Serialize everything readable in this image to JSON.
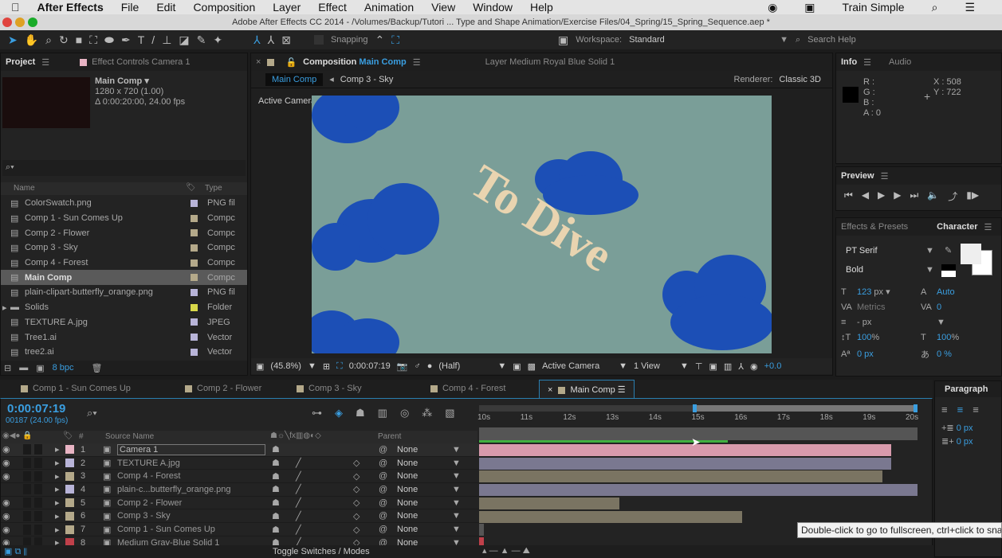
{
  "menubar": {
    "app": "After Effects",
    "items": [
      "File",
      "Edit",
      "Composition",
      "Layer",
      "Effect",
      "Animation",
      "View",
      "Window",
      "Help"
    ],
    "user": "Train Simple"
  },
  "titlebar": {
    "title": "Adobe After Effects CC 2014 - /Volumes/Backup/Tutori ... Type and Shape Animation/Exercise Files/04_Spring/15_Spring_Sequence.aep *"
  },
  "toolbar": {
    "snapping": "Snapping",
    "workspace_label": "Workspace:",
    "workspace": "Standard",
    "search_placeholder": "Search Help"
  },
  "project": {
    "tab": "Project",
    "effect_tab": "Effect Controls Camera 1",
    "comp_name": "Main Comp ▾",
    "comp_size": "1280 x 720 (1.00)",
    "comp_duration": "Δ 0:00:20:00, 24.00 fps",
    "col_name": "Name",
    "col_type": "Type",
    "bpc": "8 bpc",
    "items": [
      {
        "name": "ColorSwatch.png",
        "type": "PNG fil",
        "color": "#b8b4d8"
      },
      {
        "name": "Comp 1 - Sun Comes Up",
        "type": "Compc",
        "color": "#b4a98a"
      },
      {
        "name": "Comp 2 - Flower",
        "type": "Compc",
        "color": "#b4a98a"
      },
      {
        "name": "Comp 3 - Sky",
        "type": "Compc",
        "color": "#b4a98a"
      },
      {
        "name": "Comp 4 - Forest",
        "type": "Compc",
        "color": "#b4a98a"
      },
      {
        "name": "Main Comp",
        "type": "Compc",
        "color": "#b4a98a",
        "selected": true
      },
      {
        "name": "plain-clipart-butterfly_orange.png",
        "type": "PNG fil",
        "color": "#b8b4d8"
      },
      {
        "name": "Solids",
        "type": "Folder",
        "color": "#d8d84a"
      },
      {
        "name": "TEXTURE A.jpg",
        "type": "JPEG",
        "color": "#b8b4d8"
      },
      {
        "name": "Tree1.ai",
        "type": "Vector",
        "color": "#b8b4d8"
      },
      {
        "name": "tree2.ai",
        "type": "Vector",
        "color": "#b8b4d8"
      }
    ]
  },
  "comp": {
    "tab_prefix": "Composition",
    "tab_name": "Main Comp",
    "layer_tab": "Layer Medium Royal Blue Solid 1",
    "crumb1": "Main Comp",
    "crumb2": "Comp 3 - Sky",
    "renderer_label": "Renderer:",
    "renderer": "Classic 3D",
    "view_label": "Active Camera",
    "viewer_text": "To Dive",
    "footer": {
      "zoom": "(45.8%)",
      "time": "0:00:07:19",
      "resolution": "(Half)",
      "camera": "Active Camera",
      "views": "1 View",
      "exposure": "+0.0"
    }
  },
  "info": {
    "tab": "Info",
    "audio_tab": "Audio",
    "r": "R :",
    "g": "G :",
    "b": "B :",
    "a": "A : 0",
    "x": "X : 508",
    "y": "Y : 722"
  },
  "preview": {
    "tab": "Preview"
  },
  "character": {
    "effects_tab": "Effects & Presets",
    "tab": "Character",
    "font": "PT Serif",
    "style": "Bold",
    "size": "123",
    "size_unit": "px",
    "leading": "Auto",
    "kerning": "Metrics",
    "tracking": "0",
    "stroke": "- px",
    "vscale": "100",
    "hscale": "100",
    "pct": "%",
    "baseline": "0 px",
    "tsume": "0 %"
  },
  "paragraph": {
    "tab": "Paragraph",
    "indent1": "0 px",
    "indent2": "0 px"
  },
  "timeline": {
    "tabs": [
      "Comp 1 - Sun Comes Up",
      "Comp 2 - Flower",
      "Comp 3 - Sky",
      "Comp 4 - Forest",
      "Main Comp"
    ],
    "timecode": "0:00:07:19",
    "frames": "00187 (24.00 fps)",
    "col_source": "Source Name",
    "col_parent": "Parent",
    "col_num": "#",
    "toggle": "Toggle Switches / Modes",
    "ruler": [
      "10s",
      "11s",
      "12s",
      "13s",
      "14s",
      "15s",
      "16s",
      "17s",
      "18s",
      "19s",
      "20s"
    ],
    "layers": [
      {
        "num": "1",
        "name": "Camera 1",
        "color": "#e8b4c4",
        "parent": "None",
        "bar_end": 0.94,
        "bar_color": "#d89aac"
      },
      {
        "num": "2",
        "name": "TEXTURE A.jpg",
        "color": "#b8b4d8",
        "parent": "None",
        "bar_end": 0.94,
        "bar_color": "#7a7890"
      },
      {
        "num": "3",
        "name": "Comp 4 - Forest",
        "color": "#b4a98a",
        "parent": "None",
        "bar_end": 0.92,
        "bar_color": "#7a7462"
      },
      {
        "num": "4",
        "name": "plain-c...butterfly_orange.png",
        "color": "#b8b4d8",
        "parent": "None",
        "bar_end": 1.0,
        "bar_color": "#7a7890"
      },
      {
        "num": "5",
        "name": "Comp 2 - Flower",
        "color": "#b4a98a",
        "parent": "None",
        "bar_end": 0.32,
        "bar_color": "#7a7462"
      },
      {
        "num": "6",
        "name": "Comp 3 - Sky",
        "color": "#b4a98a",
        "parent": "None",
        "bar_end": 0.6,
        "bar_color": "#7a7462"
      },
      {
        "num": "7",
        "name": "Comp 1 - Sun Comes Up",
        "color": "#b4a98a",
        "parent": "None",
        "bar_end": 0.01,
        "bar_color": "#555"
      },
      {
        "num": "8",
        "name": "Medium Gray-Blue Solid 1",
        "color": "#c0404a",
        "parent": "None",
        "bar_end": 0.01,
        "bar_color": "#c0404a"
      }
    ]
  },
  "tooltip": "Double-click to go to fullscreen, ctrl+click to sna"
}
